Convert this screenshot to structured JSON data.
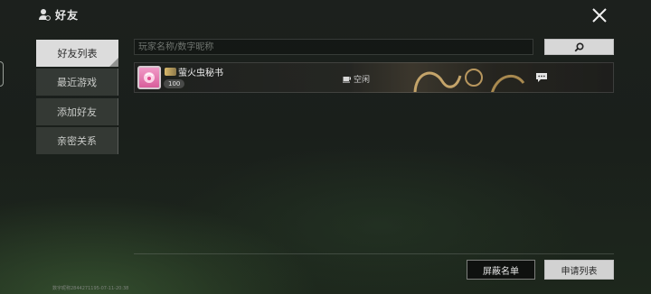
{
  "header": {
    "title": "好友",
    "icon": "user-icon"
  },
  "sidebar": {
    "tabs": [
      {
        "label": "好友列表",
        "active": true
      },
      {
        "label": "最近游戏",
        "active": false
      },
      {
        "label": "添加好友",
        "active": false
      },
      {
        "label": "亲密关系",
        "active": false
      }
    ]
  },
  "search": {
    "placeholder": "玩家名称/数字昵称",
    "button_icon": "search-icon"
  },
  "friends": [
    {
      "name": "萤火虫秘书",
      "level": "100",
      "status": "空闲",
      "status_icon": "cup-icon",
      "chat_icon": "chat-bubble-icon"
    }
  ],
  "footer": {
    "blocklist_label": "屏蔽名单",
    "requests_label": "申请列表",
    "id_text": "数字昵称2844271195-07-11-20:38"
  },
  "colors": {
    "accent_light": "#dcdcdc",
    "avatar_pink": "#e67ab3",
    "badge_gold": "#d9b86a"
  }
}
